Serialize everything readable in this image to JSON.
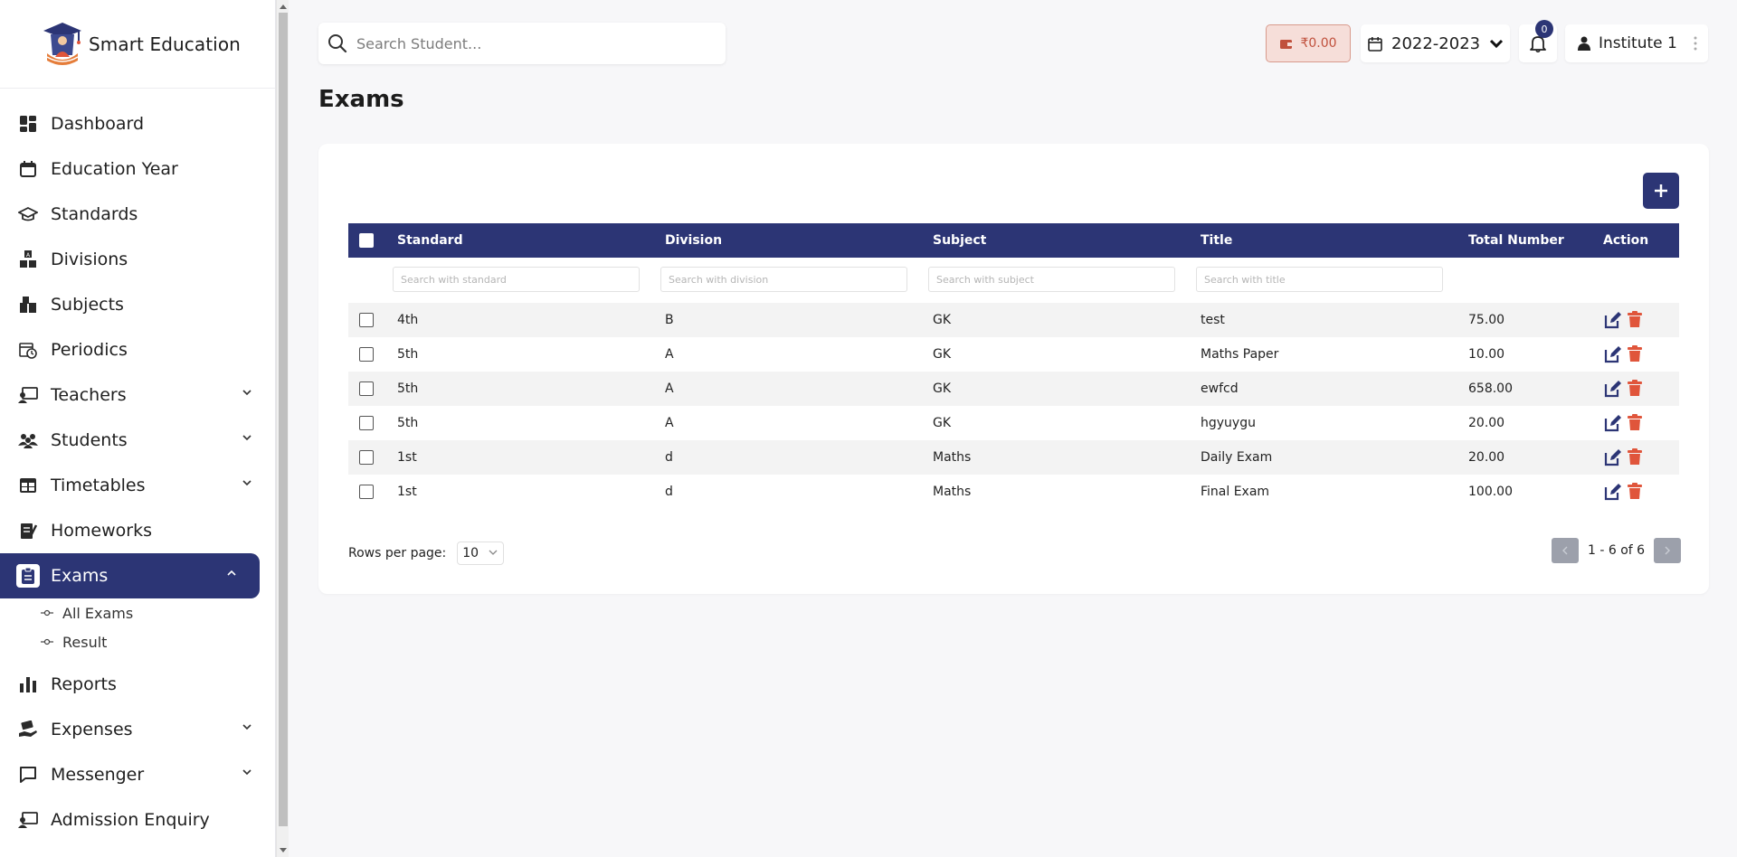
{
  "app": {
    "name": "Smart Education"
  },
  "sidebar": {
    "items": [
      {
        "label": "Dashboard",
        "icon": "dashboard-icon",
        "expandable": false
      },
      {
        "label": "Education Year",
        "icon": "calendar-icon",
        "expandable": false
      },
      {
        "label": "Standards",
        "icon": "graduation-cap-icon",
        "expandable": false
      },
      {
        "label": "Divisions",
        "icon": "abc-blocks-icon",
        "expandable": false
      },
      {
        "label": "Subjects",
        "icon": "books-icon",
        "expandable": false
      },
      {
        "label": "Periodics",
        "icon": "calendar-clock-icon",
        "expandable": false
      },
      {
        "label": "Teachers",
        "icon": "teacher-icon",
        "expandable": true
      },
      {
        "label": "Students",
        "icon": "users-icon",
        "expandable": true
      },
      {
        "label": "Timetables",
        "icon": "table-icon",
        "expandable": true
      },
      {
        "label": "Homeworks",
        "icon": "notebook-icon",
        "expandable": false
      },
      {
        "label": "Exams",
        "icon": "clipboard-icon",
        "expandable": true,
        "active": true
      },
      {
        "label": "Reports",
        "icon": "bar-chart-icon",
        "expandable": false
      },
      {
        "label": "Expenses",
        "icon": "hand-money-icon",
        "expandable": true
      },
      {
        "label": "Messenger",
        "icon": "message-icon",
        "expandable": true
      },
      {
        "label": "Admission Enquiry",
        "icon": "chalkboard-user-icon",
        "expandable": false
      }
    ],
    "exam_subitems": [
      "All Exams",
      "Result"
    ]
  },
  "header": {
    "search_placeholder": "Search Student...",
    "wallet_amount": "₹0.00",
    "year": "2022-2023",
    "notification_count": "0",
    "user": "Institute 1"
  },
  "page": {
    "title": "Exams"
  },
  "table": {
    "columns": [
      "Standard",
      "Division",
      "Subject",
      "Title",
      "Total Number",
      "Action"
    ],
    "filters": {
      "standard": "Search with standard",
      "division": "Search with division",
      "subject": "Search with subject",
      "title": "Search with title"
    },
    "rows": [
      {
        "standard": "4th",
        "division": "B",
        "subject": "GK",
        "title": "test",
        "total": "75.00"
      },
      {
        "standard": "5th",
        "division": "A",
        "subject": "GK",
        "title": "Maths Paper",
        "total": "10.00"
      },
      {
        "standard": "5th",
        "division": "A",
        "subject": "GK",
        "title": "ewfcd",
        "total": "658.00"
      },
      {
        "standard": "5th",
        "division": "A",
        "subject": "GK",
        "title": "hgyuygu",
        "total": "20.00"
      },
      {
        "standard": "1st",
        "division": "d",
        "subject": "Maths",
        "title": "Daily Exam",
        "total": "20.00"
      },
      {
        "standard": "1st",
        "division": "d",
        "subject": "Maths",
        "title": "Final Exam",
        "total": "100.00"
      }
    ]
  },
  "pagination": {
    "rows_per_page_label": "Rows per page:",
    "rows_per_page": "10",
    "range": "1 - 6 of 6"
  },
  "colors": {
    "primary": "#2c3575",
    "danger": "#e0553b",
    "wallet_bg": "#f6ded9"
  }
}
